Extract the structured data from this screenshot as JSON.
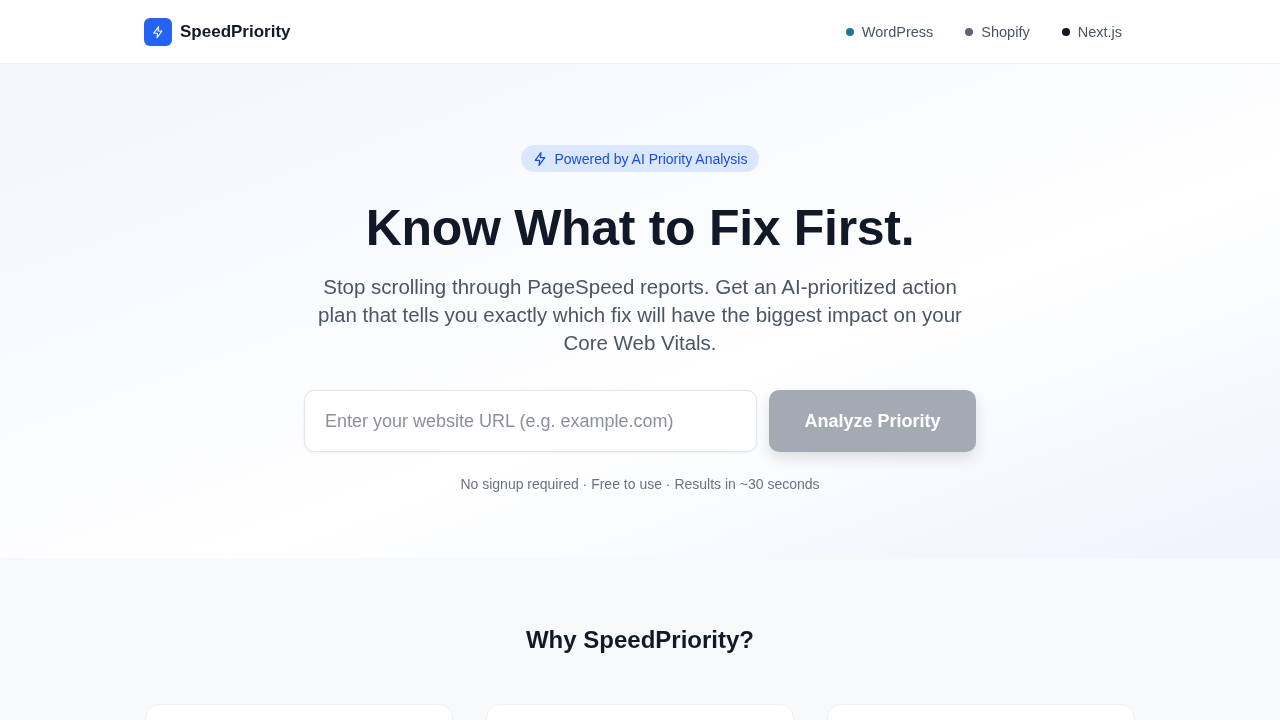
{
  "header": {
    "brand": "SpeedPriority",
    "nav": [
      {
        "label": "WordPress",
        "color": "#21759b"
      },
      {
        "label": "Shopify",
        "color": "#5c6477"
      },
      {
        "label": "Next.js",
        "color": "#111827"
      }
    ]
  },
  "hero": {
    "badge": "Powered by AI Priority Analysis",
    "title": "Know What to Fix First.",
    "subtitle": "Stop scrolling through PageSpeed reports. Get an AI-prioritized action plan that tells you exactly which fix will have the biggest impact on your Core Web Vitals.",
    "url_field": {
      "placeholder": "Enter your website URL (e.g. example.com)"
    },
    "button": {
      "label": "Analyze Priority",
      "disabled": true
    },
    "note": "No signup required · Free to use · Results in ~30 seconds"
  },
  "features": {
    "title": "Why SpeedPriority?"
  }
}
